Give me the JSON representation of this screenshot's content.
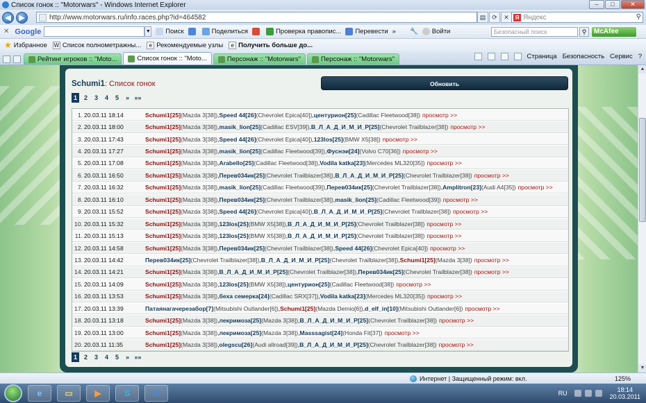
{
  "window": {
    "title": "Список гонок :: \"Motorwars\" - Windows Internet Explorer",
    "min": "–",
    "max": "□",
    "close": "✕"
  },
  "address": {
    "url": "http://www.motorwars.ru/info.races.php?id=464582",
    "search_placeholder": "Яндекс"
  },
  "google_bar": {
    "logo": "Google",
    "search_button": "Поиск",
    "share": "Поделиться",
    "spellcheck": "Проверка правопис...",
    "translate": "Перевести",
    "signin": "Войти",
    "safe_search_placeholder": "Безопасный поиск",
    "mcafee": "McAfee"
  },
  "favorites": {
    "label": "Избранное",
    "items": [
      "Список полнометражны...",
      "Рекомендуемые узлы",
      "Получить больше до..."
    ]
  },
  "tabs": [
    {
      "label": "Рейтинг игроков :: \"Moto...",
      "active": false
    },
    {
      "label": "Список гонок :: \"Moto...",
      "active": true
    },
    {
      "label": "Персонаж :: \"Motorwars\"",
      "active": false
    },
    {
      "label": "Персонаж :: \"Motorwars\"",
      "active": false
    }
  ],
  "command_bar": {
    "page": "Страница",
    "safety": "Безопасность",
    "tools": "Сервис",
    "help": "?"
  },
  "page": {
    "player": "Schumi1",
    "title_suffix": ": Список гонок",
    "refresh_button": "Обновить",
    "pager": {
      "current": "1",
      "pages": [
        "2",
        "3",
        "4",
        "5"
      ],
      "next": "»",
      "last": "»»"
    },
    "view_label": "просмотр >>"
  },
  "races": [
    {
      "n": "1.",
      "date": "20.03.11",
      "time": "18:14",
      "entries": [
        {
          "p": "Schumi1",
          "lvl": "[25]",
          "car": "(Mazda 3[38])"
        },
        {
          "p": "Speed 44",
          "lvl": "[26]",
          "car": "(Chevrolet Epica[40])"
        },
        {
          "p": "центурион",
          "lvl": "[25]",
          "car": "(Cadillac Fleetwood[38])"
        }
      ]
    },
    {
      "n": "2.",
      "date": "20.03.11",
      "time": "18:00",
      "entries": [
        {
          "p": "Schumi1",
          "lvl": "[25]",
          "car": "(Mazda 3[38])"
        },
        {
          "p": "masik_lion",
          "lvl": "[25]",
          "car": "(Cadillac ESV[39])"
        },
        {
          "p": "В_Л_А_Д_И_М_И_Р",
          "lvl": "[25]",
          "car": "(Chevrolet Trailblazer[38])"
        }
      ]
    },
    {
      "n": "3.",
      "date": "20.03.11",
      "time": "17:43",
      "entries": [
        {
          "p": "Schumi1",
          "lvl": "[25]",
          "car": "(Mazda 3[38])"
        },
        {
          "p": "Speed 44",
          "lvl": "[26]",
          "car": "(Chevrolet Epica[40])"
        },
        {
          "p": "123los",
          "lvl": "[25]",
          "car": "(BMW X5[38])"
        }
      ]
    },
    {
      "n": "4.",
      "date": "20.03.11",
      "time": "17:27",
      "entries": [
        {
          "p": "Schumi1",
          "lvl": "[25]",
          "car": "(Mazda 3[38])"
        },
        {
          "p": "masik_lion",
          "lvl": "[25]",
          "car": "(Cadillac Fleetwood[39])"
        },
        {
          "p": "Фуснэи",
          "lvl": "[24]",
          "car": "(Volvo C70[36])"
        }
      ]
    },
    {
      "n": "5.",
      "date": "20.03.11",
      "time": "17:08",
      "entries": [
        {
          "p": "Schumi1",
          "lvl": "[25]",
          "car": "(Mazda 3[38])"
        },
        {
          "p": "Arabello",
          "lvl": "[25]",
          "car": "(Cadillac Fleetwood[38])"
        },
        {
          "p": "Vodila katka",
          "lvl": "[23]",
          "car": "(Mercedes ML320[35])"
        }
      ]
    },
    {
      "n": "6.",
      "date": "20.03.11",
      "time": "16:50",
      "entries": [
        {
          "p": "Schumi1",
          "lvl": "[25]",
          "car": "(Mazda 3[38])"
        },
        {
          "p": "Перев034ик",
          "lvl": "[25]",
          "car": "(Chevrolet Trailblazer[38])"
        },
        {
          "p": "В_Л_А_Д_И_М_И_Р",
          "lvl": "[25]",
          "car": "(Chevrolet Trailblazer[38])"
        }
      ]
    },
    {
      "n": "7.",
      "date": "20.03.11",
      "time": "16:32",
      "entries": [
        {
          "p": "Schumi1",
          "lvl": "[25]",
          "car": "(Mazda 3[38])"
        },
        {
          "p": "masik_lion",
          "lvl": "[25]",
          "car": "(Cadillac Fleetwood[39])"
        },
        {
          "p": "Перев034ик",
          "lvl": "[25]",
          "car": "(Chevrolet Trailblazer[38])"
        },
        {
          "p": "Amplitron",
          "lvl": "[23]",
          "car": "(Audi A4[35])"
        }
      ]
    },
    {
      "n": "8.",
      "date": "20.03.11",
      "time": "16:10",
      "entries": [
        {
          "p": "Schumi1",
          "lvl": "[25]",
          "car": "(Mazda 3[38])"
        },
        {
          "p": "Перев034ик",
          "lvl": "[25]",
          "car": "(Chevrolet Trailblazer[38])"
        },
        {
          "p": "masik_lion",
          "lvl": "[25]",
          "car": "(Cadillac Fleetwood[39])"
        }
      ]
    },
    {
      "n": "9.",
      "date": "20.03.11",
      "time": "15:52",
      "entries": [
        {
          "p": "Schumi1",
          "lvl": "[25]",
          "car": "(Mazda 3[38])"
        },
        {
          "p": "Speed 44",
          "lvl": "[26]",
          "car": "(Chevrolet Epica[40])"
        },
        {
          "p": "В_Л_А_Д_И_М_И_Р",
          "lvl": "[25]",
          "car": "(Chevrolet Trailblazer[38])"
        }
      ]
    },
    {
      "n": "10.",
      "date": "20.03.11",
      "time": "15:32",
      "entries": [
        {
          "p": "Schumi1",
          "lvl": "[25]",
          "car": "(Mazda 3[38])"
        },
        {
          "p": "123los",
          "lvl": "[25]",
          "car": "(BMW X5[38])"
        },
        {
          "p": "В_Л_А_Д_И_М_И_Р",
          "lvl": "[25]",
          "car": "(Chevrolet Trailblazer[38])"
        }
      ]
    },
    {
      "n": "11.",
      "date": "20.03.11",
      "time": "15:13",
      "entries": [
        {
          "p": "Schumi1",
          "lvl": "[25]",
          "car": "(Mazda 3[38])"
        },
        {
          "p": "123los",
          "lvl": "[25]",
          "car": "(BMW X5[38])"
        },
        {
          "p": "В_Л_А_Д_И_М_И_Р",
          "lvl": "[25]",
          "car": "(Chevrolet Trailblazer[38])"
        }
      ]
    },
    {
      "n": "12.",
      "date": "20.03.11",
      "time": "14:58",
      "entries": [
        {
          "p": "Schumi1",
          "lvl": "[25]",
          "car": "(Mazda 3[38])"
        },
        {
          "p": "Перев034ик",
          "lvl": "[25]",
          "car": "(Chevrolet Trailblazer[38])"
        },
        {
          "p": "Speed 44",
          "lvl": "[26]",
          "car": "(Chevrolet Epica[40])"
        }
      ]
    },
    {
      "n": "13.",
      "date": "20.03.11",
      "time": "14:42",
      "entries": [
        {
          "p": "Перев034ик",
          "lvl": "[25]",
          "car": "(Chevrolet Trailblazer[38])"
        },
        {
          "p": "В_Л_А_Д_И_М_И_Р",
          "lvl": "[25]",
          "car": "(Chevrolet Trailblazer[38])"
        },
        {
          "p": "Schumi1",
          "lvl": "[25]",
          "car": "(Mazda 3[38])"
        }
      ]
    },
    {
      "n": "14.",
      "date": "20.03.11",
      "time": "14:21",
      "entries": [
        {
          "p": "Schumi1",
          "lvl": "[25]",
          "car": "(Mazda 3[38])"
        },
        {
          "p": "В_Л_А_Д_И_М_И_Р",
          "lvl": "[25]",
          "car": "(Chevrolet Trailblazer[38])"
        },
        {
          "p": "Перев034ик",
          "lvl": "[25]",
          "car": "(Chevrolet Trailblazer[38])"
        }
      ]
    },
    {
      "n": "15.",
      "date": "20.03.11",
      "time": "14:09",
      "entries": [
        {
          "p": "Schumi1",
          "lvl": "[25]",
          "car": "(Mazda 3[38])"
        },
        {
          "p": "123los",
          "lvl": "[25]",
          "car": "(BMW X5[38])"
        },
        {
          "p": "центурион",
          "lvl": "[25]",
          "car": "(Cadillac Fleetwood[38])"
        }
      ]
    },
    {
      "n": "16.",
      "date": "20.03.11",
      "time": "13:53",
      "entries": [
        {
          "p": "Schumi1",
          "lvl": "[25]",
          "car": "(Mazda 3[38])"
        },
        {
          "p": "беха семерка",
          "lvl": "[24]",
          "car": "(Cadillac SRX[37])"
        },
        {
          "p": "Vodila katka",
          "lvl": "[23]",
          "car": "(Mercedes ML320[35])"
        }
      ]
    },
    {
      "n": "17.",
      "date": "20.03.11",
      "time": "13:39",
      "entries": [
        {
          "p": "Патаянагачерезабор",
          "lvl": "[7]",
          "car": "(Mitsubishi Outlander[6])"
        },
        {
          "p": "Schumi1",
          "lvl": "[25]",
          "car": "(Mazda Demio[6])"
        },
        {
          "p": "d_elf_in",
          "lvl": "[10]",
          "car": "(Mitsubishi Outlander[6])"
        }
      ]
    },
    {
      "n": "18.",
      "date": "20.03.11",
      "time": "13:18",
      "entries": [
        {
          "p": "Schumi1",
          "lvl": "[25]",
          "car": "(Mazda 3[38])"
        },
        {
          "p": "лекримоза",
          "lvl": "[25]",
          "car": "(Mazda 3[38])"
        },
        {
          "p": "В_Л_А_Д_И_М_И_Р",
          "lvl": "[25]",
          "car": "(Chevrolet Trailblazer[38])"
        }
      ]
    },
    {
      "n": "19.",
      "date": "20.03.11",
      "time": "13:00",
      "entries": [
        {
          "p": "Schumi1",
          "lvl": "[25]",
          "car": "(Mazda 3[38])"
        },
        {
          "p": "лекримоза",
          "lvl": "[25]",
          "car": "(Mazda 3[38])"
        },
        {
          "p": "Masssagist",
          "lvl": "[24]",
          "car": "(Honda Fit[37])"
        }
      ]
    },
    {
      "n": "20.",
      "date": "20.03.11",
      "time": "11:35",
      "entries": [
        {
          "p": "Schumi1",
          "lvl": "[25]",
          "car": "(Mazda 3[38])"
        },
        {
          "p": "olegscu",
          "lvl": "[26]",
          "car": "(Audi allroad[39])"
        },
        {
          "p": "В_Л_А_Д_И_М_И_Р",
          "lvl": "[25]",
          "car": "(Chevrolet Trailblazer[38])"
        }
      ]
    }
  ],
  "status": {
    "zone": "Интернет | Защищенный режим: вкл.",
    "zoom": "125%"
  },
  "taskbar": {
    "lang": "RU",
    "time": "18:14",
    "date": "20.03.2011"
  },
  "colors": {
    "accent": "#153a5a",
    "me": "#8b1010",
    "view_link": "#a4150f",
    "frame": "#1e4e50"
  }
}
